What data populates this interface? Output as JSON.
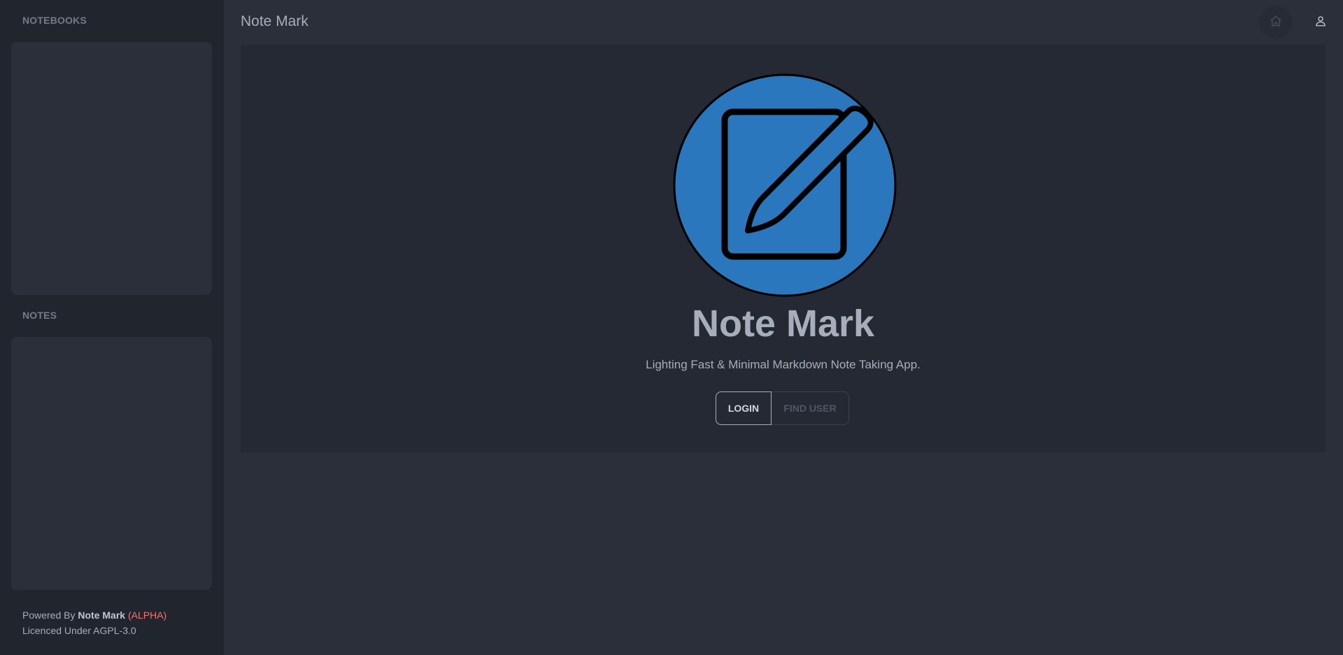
{
  "sidebar": {
    "notebooks_title": "NOTEBOOKS",
    "notes_title": "NOTES",
    "footer": {
      "powered_by": "Powered By",
      "brand": "Note Mark",
      "alpha": "(ALPHA)",
      "licence": "Licenced Under AGPL-3.0"
    }
  },
  "header": {
    "title": "Note Mark",
    "icons": [
      "home-icon",
      "user-icon"
    ]
  },
  "hero": {
    "title": "Note Mark",
    "subtitle": "Lighting Fast & Minimal Markdown Note Taking App.",
    "login_label": "LOGIN",
    "find_user_label": "FIND USER",
    "logo_icon": "note-pencil-logo"
  },
  "colors": {
    "sidebar_bg": "#20252e",
    "main_bg": "#2a2f3a",
    "hero_bg": "#242933",
    "logo_blue": "#2b77bd",
    "alpha_red": "#f87272"
  }
}
